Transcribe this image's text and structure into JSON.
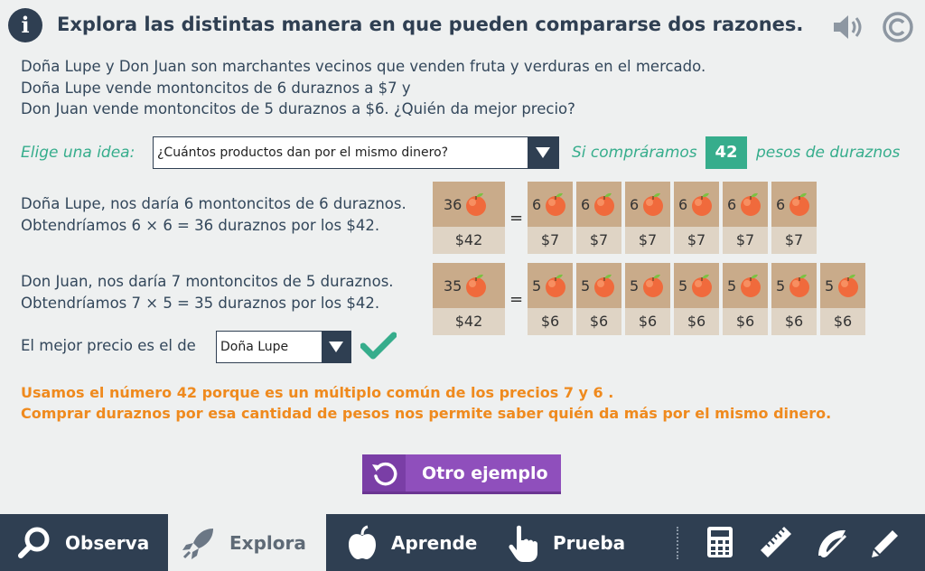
{
  "header": {
    "title": "Explora las distintas manera en que pueden compararse dos razones."
  },
  "problem": {
    "line1": "Doña Lupe y Don Juan son marchantes vecinos que venden fruta y verduras en el mercado.",
    "line2": "Doña Lupe vende montoncitos de 6 duraznos a $7 y",
    "line3": "Don Juan vende montoncitos de 5 duraznos a $6. ¿Quién da mejor precio?"
  },
  "idea": {
    "label": "Elige una idea:",
    "selected": "¿Cuántos productos dan por el mismo dinero?",
    "si_compraramos": "Si compráramos",
    "amount": "42",
    "pesos_label": "pesos de duraznos"
  },
  "lupe": {
    "line1": "Doña Lupe, nos daría 6 montoncitos de 6 duraznos.",
    "line2": "Obtendríamos 6 × 6 = 36 duraznos por los $42.",
    "total_count": "36",
    "total_price": "$42",
    "pile_count": "6",
    "pile_price": "$7",
    "piles": 6
  },
  "juan": {
    "line1": "Don Juan, nos daría 7 montoncitos de 5 duraznos.",
    "line2": "Obtendríamos 7 × 5 = 35 duraznos por los $42.",
    "total_count": "35",
    "total_price": "$42",
    "pile_count": "5",
    "pile_price": "$6",
    "piles": 7
  },
  "equals": "=",
  "answer": {
    "label": "El mejor precio es el de",
    "selected": "Doña Lupe"
  },
  "explanation": {
    "line1": "Usamos el número   42  porque es un múltiplo común de los precios   7  y   6 .",
    "line2": "Comprar   duraznos  por esa cantidad de pesos nos permite saber quién da más por el mismo dinero."
  },
  "button": {
    "label": "Otro ejemplo"
  },
  "nav": {
    "observa": "Observa",
    "explora": "Explora",
    "aprende": "Aprende",
    "prueba": "Prueba"
  },
  "colors": {
    "navy": "#2f3f52",
    "green": "#36ad8c",
    "orange": "#ef8a1e",
    "purple": "#8f4fbc",
    "tile_dark": "#c9ab8a",
    "tile_light": "#dfd4c5"
  }
}
